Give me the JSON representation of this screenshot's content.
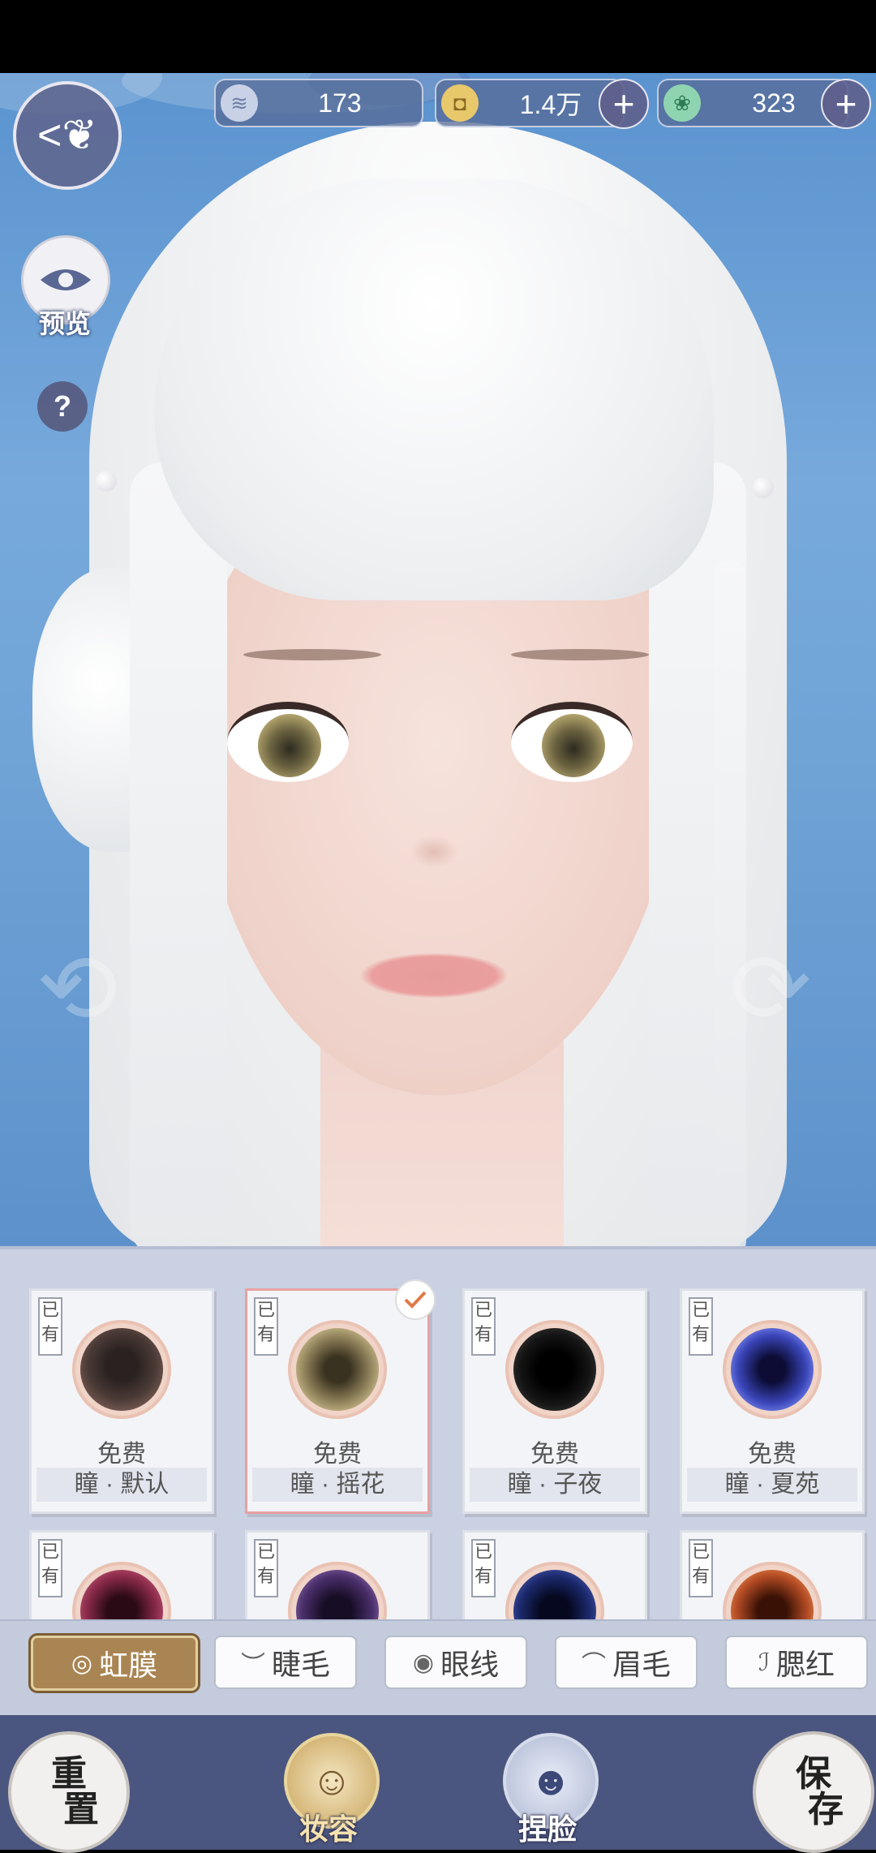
{
  "currencies": [
    {
      "icon": "silver-coin-icon",
      "value": "173",
      "has_plus": false
    },
    {
      "icon": "gold-coin-icon",
      "value": "1.4万",
      "has_plus": true
    },
    {
      "icon": "jade-icon",
      "value": "323",
      "has_plus": true
    }
  ],
  "preview": {
    "label": "预览"
  },
  "help": {
    "label": "?"
  },
  "items_row1": [
    {
      "owned": "已有",
      "price": "免费",
      "name": "瞳 · 默认",
      "color": "#4a3a36",
      "selected": false
    },
    {
      "owned": "已有",
      "price": "免费",
      "name": "瞳 · 摇花",
      "color": "#8d7f58",
      "selected": true
    },
    {
      "owned": "已有",
      "price": "免费",
      "name": "瞳 · 子夜",
      "color": "#151515",
      "selected": false
    },
    {
      "owned": "已有",
      "price": "免费",
      "name": "瞳 · 夏苑",
      "color": "#3a45b8",
      "selected": false
    }
  ],
  "items_row2": [
    {
      "owned": "已有",
      "color": "#8b2a4a"
    },
    {
      "owned": "已有",
      "color": "#4a2f6b"
    },
    {
      "owned": "已有",
      "color": "#1c2a6e"
    },
    {
      "owned": "已有",
      "color": "#b24a24"
    }
  ],
  "tabs": [
    {
      "label": "虹膜",
      "icon": "◎",
      "active": true
    },
    {
      "label": "睫毛",
      "icon": "︶",
      "active": false
    },
    {
      "label": "眼线",
      "icon": "◉",
      "active": false
    },
    {
      "label": "眉毛",
      "icon": "⌒",
      "active": false
    },
    {
      "label": "腮红",
      "icon": "ℐ",
      "active": false
    }
  ],
  "bottom": {
    "reset": [
      "重",
      "置"
    ],
    "save": [
      "保",
      "存"
    ],
    "makeup_label": "妆容",
    "face_label": "捏脸"
  }
}
